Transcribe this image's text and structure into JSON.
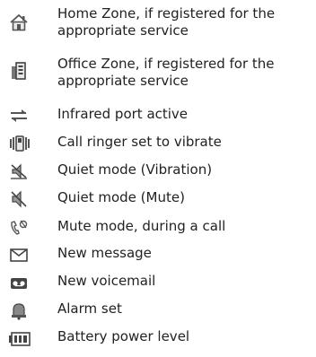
{
  "items": [
    {
      "icon": "home-zone-icon",
      "text": "Home Zone, if registered for the appropriate service"
    },
    {
      "icon": "office-zone-icon",
      "text": "Office Zone, if registered for the appropriate service"
    },
    {
      "icon": "infrared-port-icon",
      "text": "Infrared port active"
    },
    {
      "icon": "vibrate-ringer-icon",
      "text": "Call ringer set to vibrate"
    },
    {
      "icon": "quiet-vibration-icon",
      "text": "Quiet mode (Vibration)"
    },
    {
      "icon": "quiet-mute-icon",
      "text": "Quiet mode (Mute)"
    },
    {
      "icon": "mute-call-icon",
      "text": "Mute mode, during a call"
    },
    {
      "icon": "new-message-icon",
      "text": "New message"
    },
    {
      "icon": "new-voicemail-icon",
      "text": "New voicemail"
    },
    {
      "icon": "alarm-icon",
      "text": "Alarm set"
    },
    {
      "icon": "battery-icon",
      "text": "Battery power level"
    }
  ]
}
